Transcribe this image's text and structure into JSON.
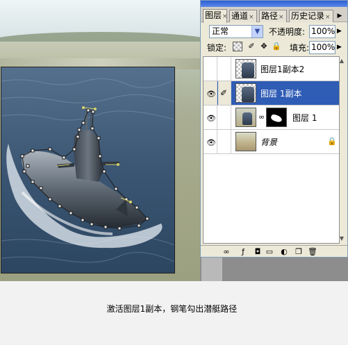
{
  "panel": {
    "tabs": [
      {
        "label": "图层",
        "active": true
      },
      {
        "label": "通道",
        "active": false
      },
      {
        "label": "路径",
        "active": false
      },
      {
        "label": "历史记录",
        "active": false
      }
    ],
    "blend_mode": "正常",
    "opacity_label": "不透明度:",
    "opacity_value": "100%",
    "lock_label": "锁定:",
    "fill_label": "填充:",
    "fill_value": "100%",
    "layers": [
      {
        "name": "图层1副本2",
        "visible": false,
        "selected": false
      },
      {
        "name": "图层 1副本",
        "visible": true,
        "selected": true
      },
      {
        "name": "图层 1",
        "visible": true,
        "selected": false
      },
      {
        "name": "背景",
        "visible": true,
        "selected": false
      }
    ]
  },
  "icons": {
    "eye": "👁",
    "brush": "✐",
    "chain": "🔗",
    "lock": "🔒",
    "move": "✥",
    "dropdown": "▼",
    "arrow_right": "▶"
  },
  "caption": "激活图层1副本，钢笔勾出潜艇路径",
  "colors": {
    "selection_blue": "#2f5cb5",
    "panel_bg": "#ece9d8",
    "path_anchor": "#222222",
    "path_handle": "#d7d36a"
  }
}
